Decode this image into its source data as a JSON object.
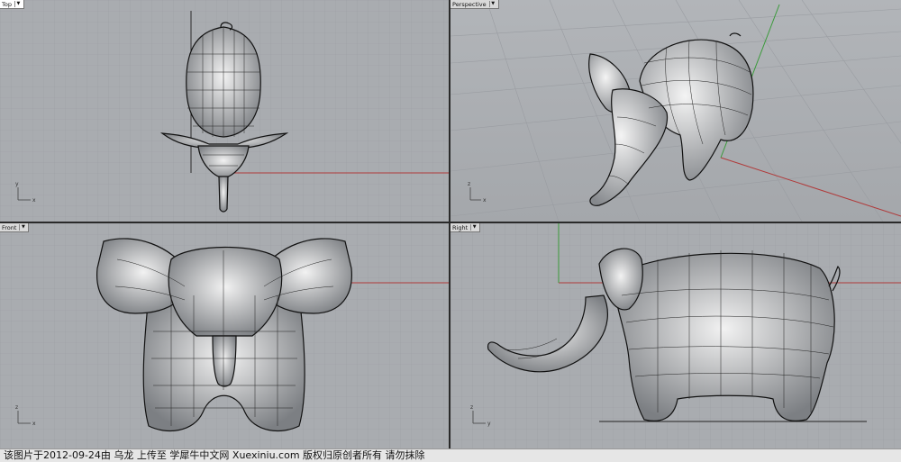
{
  "viewports": {
    "top": {
      "label": "Top"
    },
    "perspective": {
      "label": "Perspective"
    },
    "front": {
      "label": "Front"
    },
    "right": {
      "label": "Right"
    }
  },
  "axes": {
    "x": "x",
    "y": "y",
    "z": "z"
  },
  "footer": {
    "text": "该图片于2012-09-24由 乌龙 上传至 学犀牛中文网 Xuexiniu.com 版权归原创者所有 请勿抹除"
  },
  "colors": {
    "viewport_bg": "#a9acb0",
    "grid": "#9b9ea3",
    "x_axis": "#b03a3a",
    "y_axis": "#3a9a3a",
    "wire": "#111111"
  }
}
